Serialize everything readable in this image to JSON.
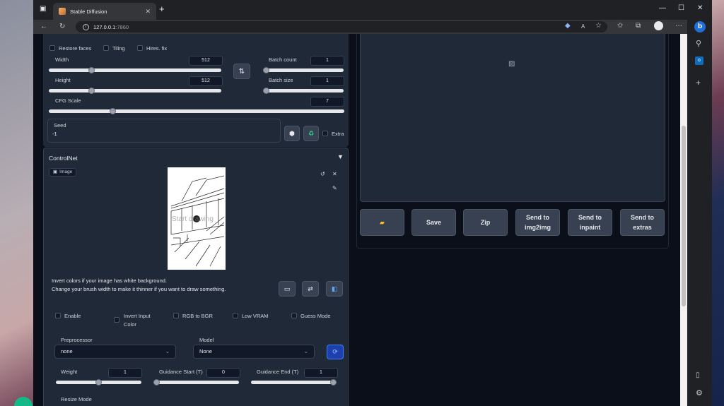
{
  "browser": {
    "tab_title": "Stable Diffusion",
    "url_host": "127.0.0.1",
    "url_port": ":7860"
  },
  "options": {
    "restore_faces": "Restore faces",
    "tiling": "Tiling",
    "hires_fix": "Hires. fix"
  },
  "width": {
    "label": "Width",
    "value": "512",
    "fraction": 0.24
  },
  "height": {
    "label": "Height",
    "value": "512",
    "fraction": 0.24
  },
  "batch_count": {
    "label": "Batch count",
    "value": "1",
    "fraction": 0.0
  },
  "batch_size": {
    "label": "Batch size",
    "value": "1",
    "fraction": 0.0
  },
  "cfg_scale": {
    "label": "CFG Scale",
    "value": "7",
    "fraction": 0.21
  },
  "seed": {
    "label": "Seed",
    "value": "-1",
    "extra": "Extra"
  },
  "controlnet": {
    "title": "ControlNet",
    "image_label": "Image",
    "canvas_overlay": "Start drawing",
    "hint1": "Invert colors if your image has white background.",
    "hint2": "Change your brush width to make it thinner if you want to draw something.",
    "enable": "Enable",
    "invert_input": "Invert Input",
    "invert_input2": "Color",
    "rgb_to_bgr": "RGB to BGR",
    "low_vram": "Low VRAM",
    "guess_mode": "Guess Mode",
    "preprocessor_label": "Preprocessor",
    "preprocessor_value": "none",
    "model_label": "Model",
    "model_value": "None",
    "weight_label": "Weight",
    "weight_value": "1",
    "weight_fraction": 0.5,
    "guidance_start_label": "Guidance Start (T)",
    "guidance_start_value": "0",
    "guidance_start_fraction": 0.0,
    "guidance_end_label": "Guidance End (T)",
    "guidance_end_value": "1",
    "guidance_end_fraction": 1.0,
    "resize_mode_label": "Resize Mode"
  },
  "output_buttons": {
    "folder_icon": "folder-icon",
    "save": "Save",
    "zip": "Zip",
    "img2img_1": "Send to",
    "img2img_2": "img2img",
    "inpaint_1": "Send to",
    "inpaint_2": "inpaint",
    "extras_1": "Send to",
    "extras_2": "extras"
  },
  "colors": {
    "panel_bg": "#1f2937",
    "page_bg": "#0b0f19",
    "accent_blue": "#3b82f6"
  }
}
